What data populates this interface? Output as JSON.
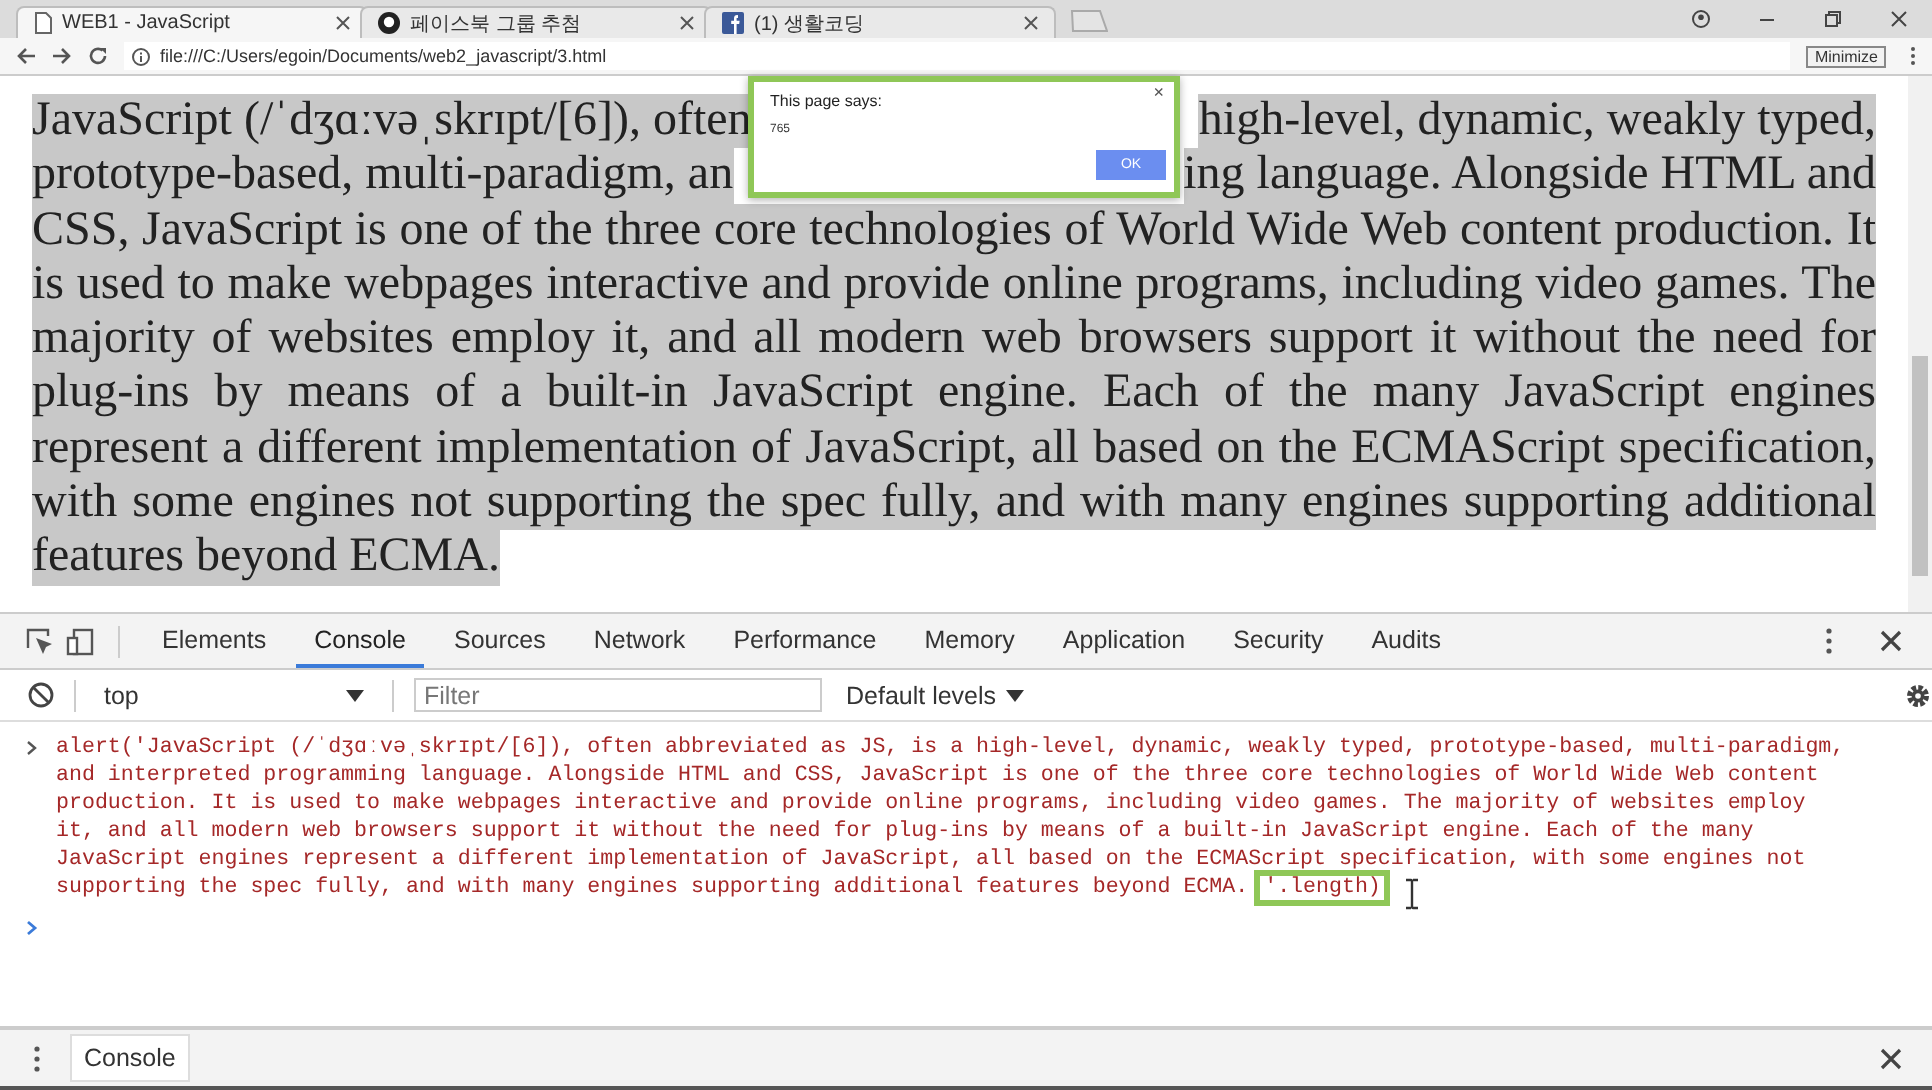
{
  "browser": {
    "tabs": [
      {
        "title": "WEB1 - JavaScript",
        "selected": true
      },
      {
        "title": "페이스북 그룹 추첨",
        "selected": false
      },
      {
        "title": "(1) 생활코딩",
        "selected": false
      }
    ],
    "address": "file:///C:/Users/egoin/Documents/web2_javascript/3.html",
    "tooltip": "Minimize"
  },
  "page": {
    "lines": [
      {
        "segments": [
          "JavaScript (/ˈdʒɑːvəˌskrɪpt/[6]), often",
          "high-level, dynamic, weakly typed,"
        ]
      },
      {
        "segments": [
          "prototype-based, multi-paradigm, an",
          "ing language. Alongside HTML and"
        ]
      },
      {
        "segments": [
          "CSS, JavaScript is one of the three core technologies of World Wide Web content production. It"
        ]
      },
      {
        "segments": [
          "is used to make webpages interactive and provide online programs, including video games. The"
        ]
      },
      {
        "segments": [
          "majority of websites employ it, and all modern web browsers support it without the need for"
        ]
      },
      {
        "segments": [
          "plug-ins by means of a built-in JavaScript engine. Each of the many JavaScript engines"
        ]
      },
      {
        "segments": [
          "represent a different implementation of JavaScript, all based on the ECMAScript specification,"
        ]
      },
      {
        "segments": [
          "with some engines not supporting the spec fully, and with many engines supporting additional"
        ]
      },
      {
        "segments": [
          "features beyond ECMA."
        ]
      }
    ]
  },
  "dialog": {
    "title": "This page says:",
    "message": "765",
    "button": "OK",
    "close": "×"
  },
  "devtools": {
    "tabs": [
      {
        "label": "Elements",
        "selected": false
      },
      {
        "label": "Console",
        "selected": true
      },
      {
        "label": "Sources",
        "selected": false
      },
      {
        "label": "Network",
        "selected": false
      },
      {
        "label": "Performance",
        "selected": false
      },
      {
        "label": "Memory",
        "selected": false
      },
      {
        "label": "Application",
        "selected": false
      },
      {
        "label": "Security",
        "selected": false
      },
      {
        "label": "Audits",
        "selected": false
      }
    ],
    "context": "top",
    "filter_placeholder": "Filter",
    "levels": "Default levels",
    "console": {
      "input_lines": [
        "alert('JavaScript (/ˈdʒɑːvəˌskrɪpt/[6]), often abbreviated as JS, is a high-level, dynamic, weakly typed, prototype-based, multi-paradigm,",
        "and interpreted programming language. Alongside HTML and CSS, JavaScript is one of the three core technologies of World Wide Web content",
        "production. It is used to make webpages interactive and provide online programs, including video games. The majority of websites employ",
        "it, and all modern web browsers support it without the need for plug-ins by means of a built-in JavaScript engine. Each of the many",
        "JavaScript engines represent a different implementation of JavaScript, all based on the ECMAScript specification, with some engines not",
        "supporting the spec fully, and with many engines supporting additional features beyond ECMA."
      ],
      "highlighted_tail": "'.length)"
    },
    "drawer_tab": "Console"
  }
}
